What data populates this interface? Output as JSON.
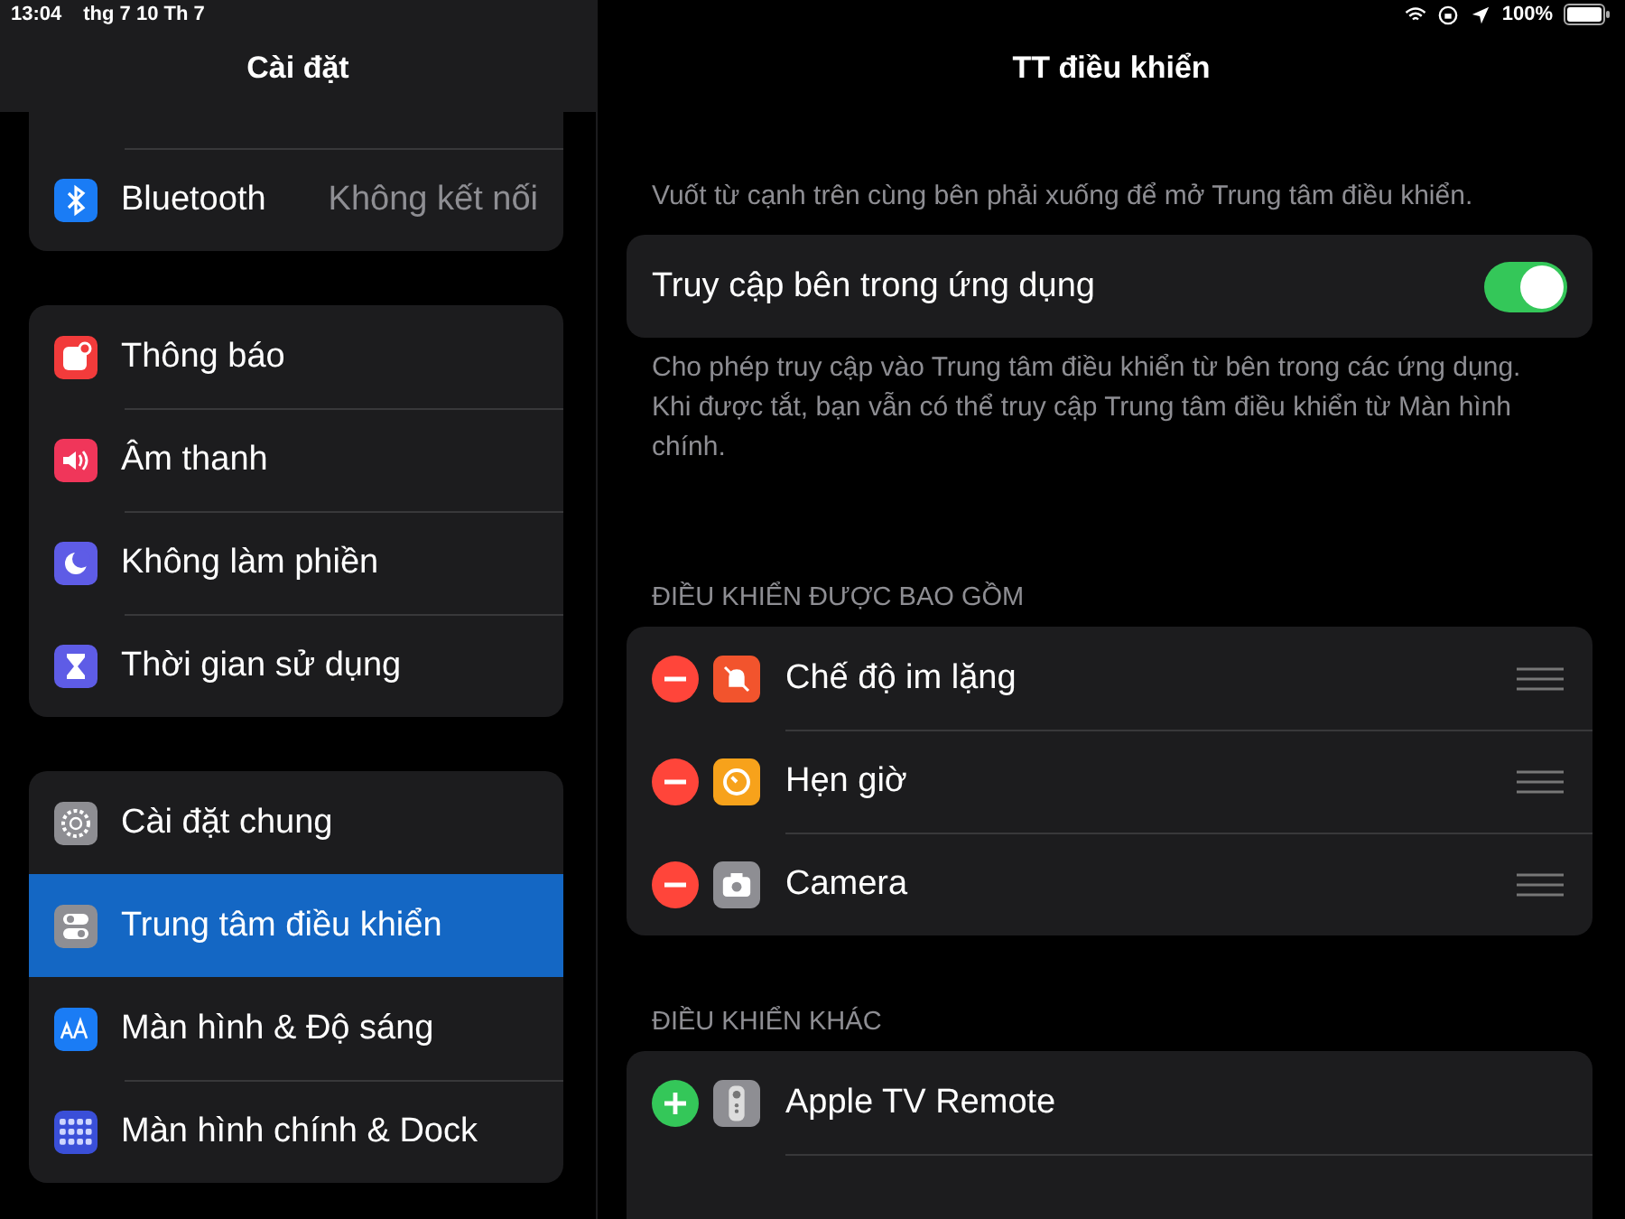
{
  "status_bar": {
    "time": "13:04",
    "date": "thg 7 10 Th 7",
    "battery": "100%"
  },
  "sidebar": {
    "title": "Cài đặt",
    "groups": [
      [
        {
          "label": "Bluetooth",
          "value": "Không kết nối",
          "kind": "bluetooth",
          "color": "#1a7cf5",
          "selected": false
        }
      ],
      [
        {
          "label": "Thông báo",
          "kind": "notification",
          "color": "#f23b3b",
          "selected": false
        },
        {
          "label": "Âm thanh",
          "kind": "sound",
          "color": "#f0365a",
          "selected": false
        },
        {
          "label": "Không làm phiền",
          "kind": "moon",
          "color": "#5e5ce6",
          "selected": false
        },
        {
          "label": "Thời gian sử dụng",
          "kind": "hourglass",
          "color": "#5e5ce6",
          "selected": false
        }
      ],
      [
        {
          "label": "Cài đặt chung",
          "kind": "gear",
          "color": "#8e8e93",
          "selected": false
        },
        {
          "label": "Trung tâm điều khiển",
          "kind": "switches",
          "color": "#8e8e93",
          "selected": true
        },
        {
          "label": "Màn hình & Độ sáng",
          "kind": "textsize",
          "color": "#1a7cf5",
          "selected": false
        },
        {
          "label": "Màn hình chính & Dock",
          "kind": "grid",
          "color": "#3a4fd8",
          "selected": false
        }
      ]
    ]
  },
  "detail": {
    "title": "TT điều khiển",
    "intro": "Vuốt từ cạnh trên cùng bên phải xuống để mở Trung tâm điều khiển.",
    "toggle": {
      "label": "Truy cập bên trong ứng dụng",
      "on": true
    },
    "toggle_note": "Cho phép truy cập vào Trung tâm điều khiển từ bên trong các ứng dụng. Khi được tắt, bạn vẫn có thể truy cập Trung tâm điều khiển từ Màn hình chính.",
    "sections": [
      {
        "header": "ĐIỀU KHIỂN ĐƯỢC BAO GỒM",
        "kind": "included",
        "items": [
          {
            "label": "Chế độ im lặng",
            "kind": "silent",
            "color": "#f2542d"
          },
          {
            "label": "Hẹn giờ",
            "kind": "timer",
            "color": "#f7a21b"
          },
          {
            "label": "Camera",
            "kind": "camera",
            "color": "#8e8e93"
          }
        ]
      },
      {
        "header": "ĐIỀU KHIỂN KHÁC",
        "kind": "available",
        "items": [
          {
            "label": "Apple TV Remote",
            "kind": "remote",
            "color": "#8e8e93"
          }
        ]
      }
    ]
  }
}
